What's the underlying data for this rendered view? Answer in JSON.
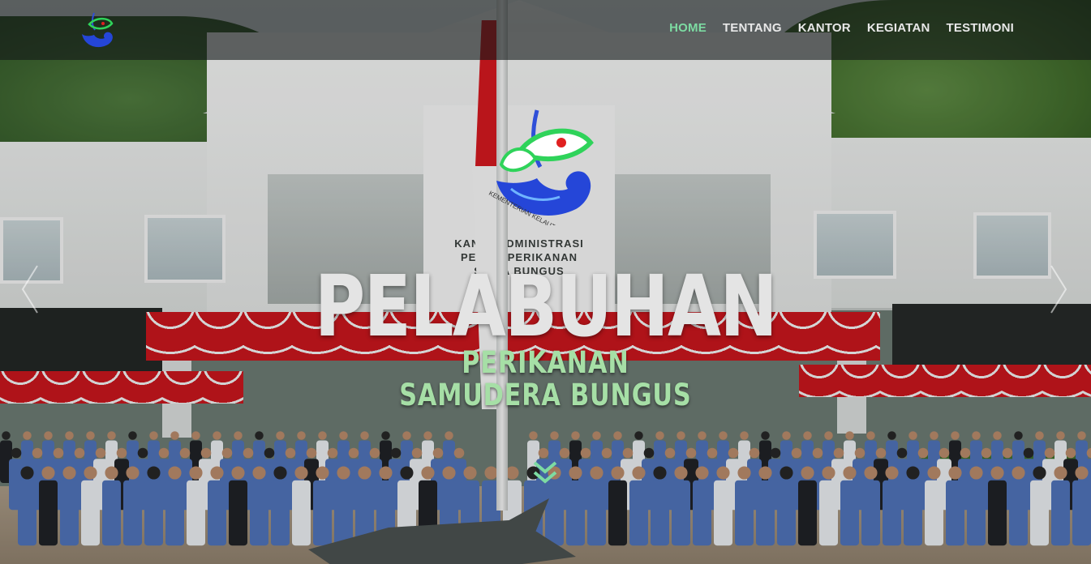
{
  "nav": {
    "brand_icon": "fish-logo-icon",
    "items": [
      {
        "label": "HOME",
        "active": true
      },
      {
        "label": "TENTANG",
        "active": false
      },
      {
        "label": "KANTOR",
        "active": false
      },
      {
        "label": "KEGIATAN",
        "active": false
      },
      {
        "label": "TESTIMONI",
        "active": false
      }
    ]
  },
  "hero": {
    "title": "PELABUHAN",
    "subtitle": "PERIKANAN SAMUDERA BUNGUS",
    "sign_lines": [
      "KANYA ADMINISTRASI",
      "PELA  N  PERIKANAN",
      "SA   RA BUNGUS"
    ],
    "logo_caption": "KEMENTERIAN KELAUTAN DAN PERIKANAN",
    "scroll_icon": "double-chevron-down-icon",
    "prev_icon": "chevron-left-icon",
    "next_icon": "chevron-right-icon"
  },
  "colors": {
    "nav_active": "#7ddba2",
    "nav_text": "#e8e8e8",
    "title": "#e4e4e4",
    "subtitle": "#a6dfa6"
  }
}
